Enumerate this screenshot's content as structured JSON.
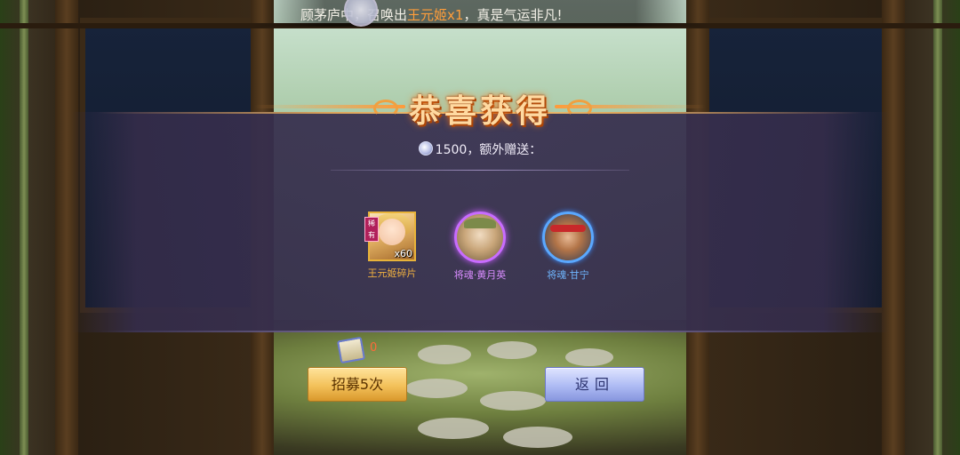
{
  "top_banner": {
    "prefix": "顾茅庐中，召唤出",
    "highlight": "王元姬x1",
    "suffix": "，真是气运非凡!"
  },
  "panel": {
    "title": "恭喜获得",
    "reward_amount": "1500",
    "reward_suffix": "，额外赠送：",
    "currency_icon": "silver-coin-icon"
  },
  "items": [
    {
      "name": "王元姬碎片",
      "badge": "稀有",
      "quantity": "x60",
      "name_color": "#f0b040",
      "frame": "gold-square"
    },
    {
      "name": "将魂·黄月英",
      "name_color": "#d98cff",
      "frame": "purple-round"
    },
    {
      "name": "将魂·甘宁",
      "name_color": "#6fb6ff",
      "frame": "blue-round"
    }
  ],
  "bottom": {
    "scroll_count": "0",
    "recruit_button": "招募5次",
    "back_button": "返回"
  },
  "colors": {
    "title_glow": "#ff7a1a",
    "highlight": "#ff9d3a",
    "recruit_button": "#f3c15a",
    "back_button": "#aebbf4"
  }
}
